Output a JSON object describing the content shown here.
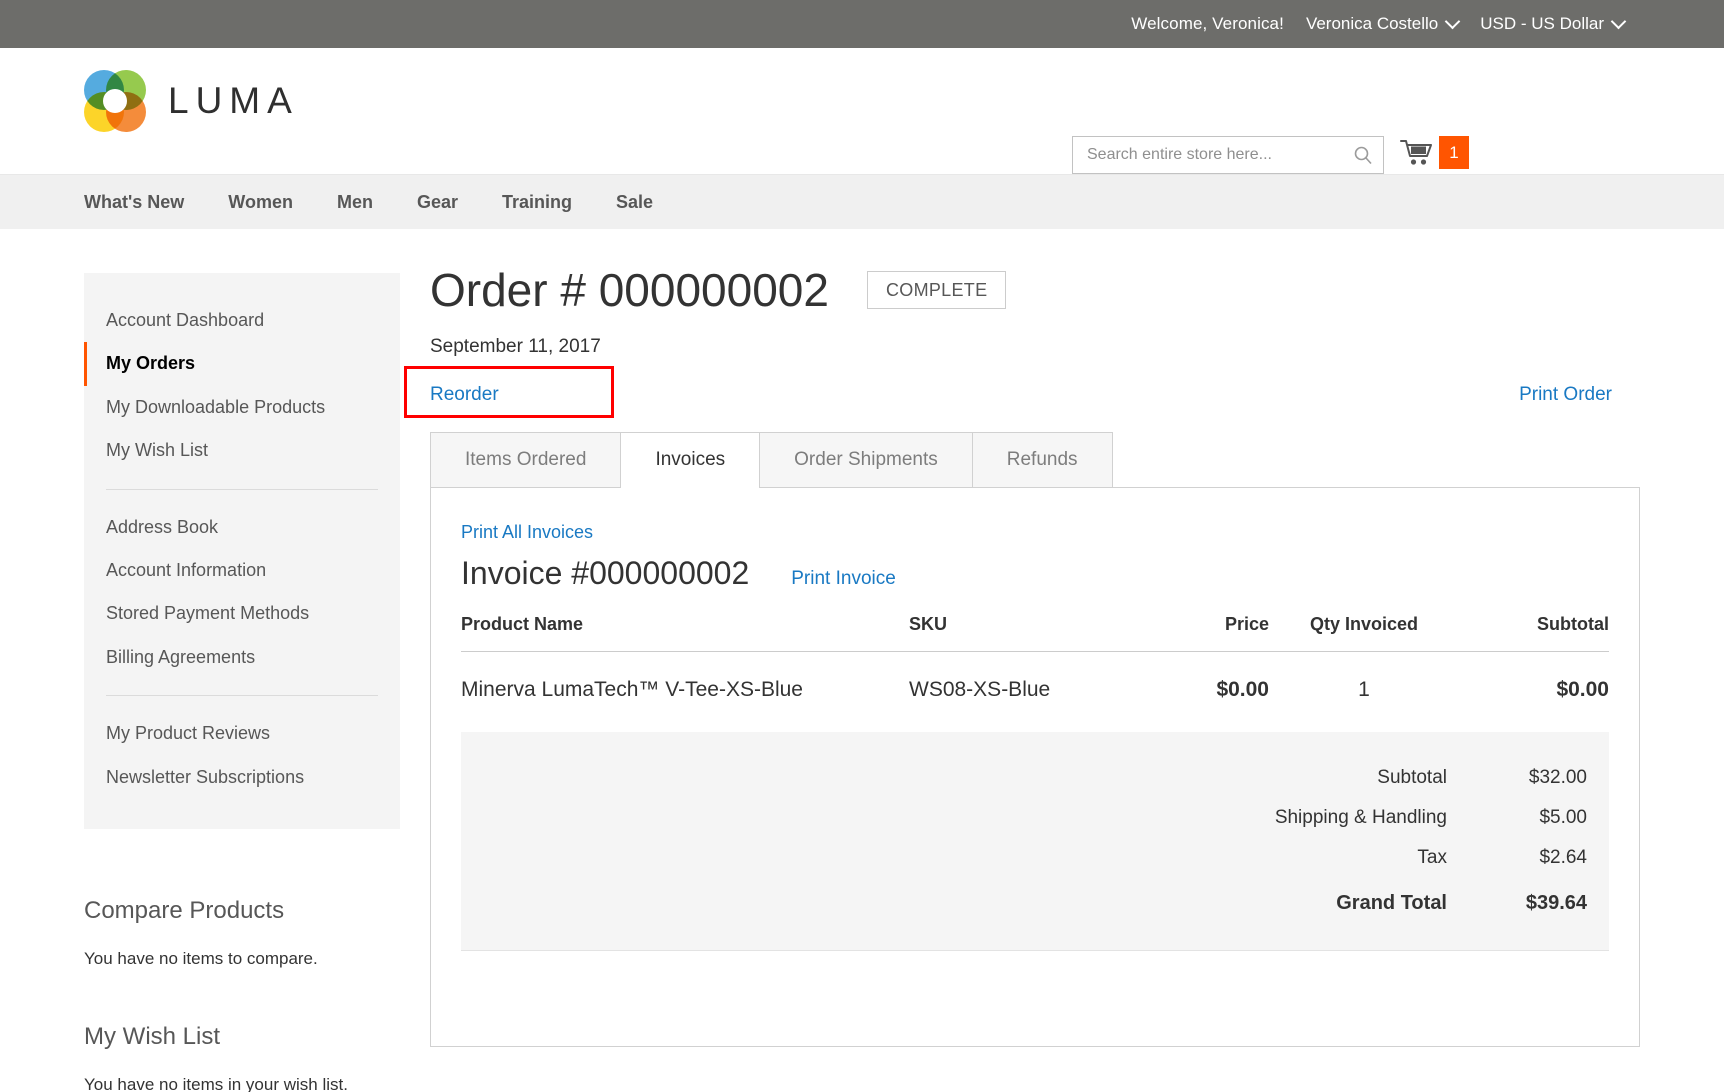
{
  "top_panel": {
    "welcome": "Welcome, Veronica!",
    "account_switcher": "Veronica Costello",
    "currency_switcher": "USD - US Dollar"
  },
  "header": {
    "logo_text": "LUMA",
    "search_placeholder": "Search entire store here...",
    "search_value": "",
    "cart_count": "1"
  },
  "nav": {
    "items": [
      {
        "label": "What's New"
      },
      {
        "label": "Women"
      },
      {
        "label": "Men"
      },
      {
        "label": "Gear"
      },
      {
        "label": "Training"
      },
      {
        "label": "Sale"
      }
    ]
  },
  "sidebar": {
    "group1": [
      {
        "label": "Account Dashboard",
        "current": false
      },
      {
        "label": "My Orders",
        "current": true
      },
      {
        "label": "My Downloadable Products",
        "current": false
      },
      {
        "label": "My Wish List",
        "current": false
      }
    ],
    "group2": [
      {
        "label": "Address Book"
      },
      {
        "label": "Account Information"
      },
      {
        "label": "Stored Payment Methods"
      },
      {
        "label": "Billing Agreements"
      }
    ],
    "group3": [
      {
        "label": "My Product Reviews"
      },
      {
        "label": "Newsletter Subscriptions"
      }
    ],
    "compare_products": {
      "title": "Compare Products",
      "empty_text": "You have no items to compare."
    },
    "my_wish_list": {
      "title": "My Wish List",
      "empty_text": "You have no items in your wish list."
    }
  },
  "main": {
    "order_title": "Order # 000000002",
    "order_status": "COMPLETE",
    "order_date": "September 11, 2017",
    "reorder_label": "Reorder",
    "print_order_label": "Print Order",
    "tabs": [
      {
        "label": "Items Ordered",
        "active": false
      },
      {
        "label": "Invoices",
        "active": true
      },
      {
        "label": "Order Shipments",
        "active": false
      },
      {
        "label": "Refunds",
        "active": false
      }
    ],
    "invoice": {
      "print_all_label": "Print All Invoices",
      "title": "Invoice #000000002",
      "print_invoice_label": "Print Invoice",
      "columns": {
        "product_name": "Product Name",
        "sku": "SKU",
        "price": "Price",
        "qty_invoiced": "Qty Invoiced",
        "subtotal": "Subtotal"
      },
      "rows": [
        {
          "product_name": "Minerva LumaTech™ V-Tee-XS-Blue",
          "sku": "WS08-XS-Blue",
          "price": "$0.00",
          "qty_invoiced": "1",
          "subtotal": "$0.00"
        }
      ],
      "totals": [
        {
          "label": "Subtotal",
          "value": "$32.00",
          "grand": false
        },
        {
          "label": "Shipping & Handling",
          "value": "$5.00",
          "grand": false
        },
        {
          "label": "Tax",
          "value": "$2.64",
          "grand": false
        },
        {
          "label": "Grand Total",
          "value": "$39.64",
          "grand": true
        }
      ]
    }
  },
  "annotation": {
    "highlight_color": "#ff0000",
    "target": "Reorder"
  }
}
